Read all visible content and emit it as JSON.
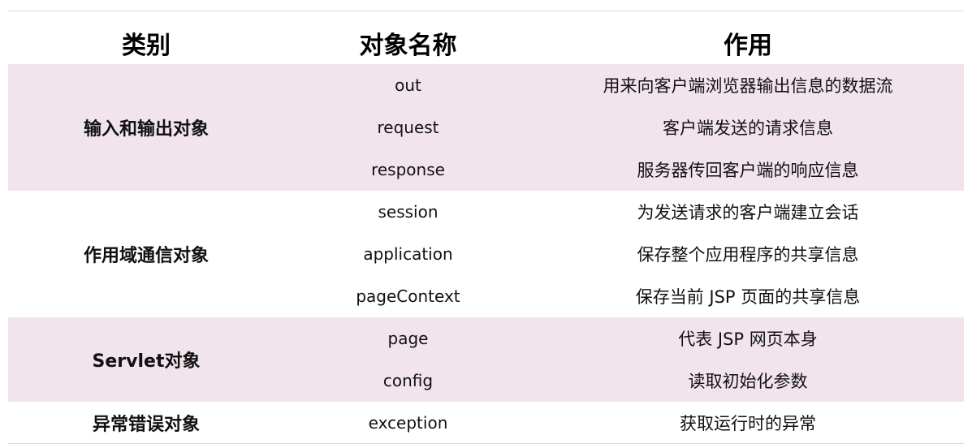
{
  "headers": {
    "category": "类别",
    "name": "对象名称",
    "purpose": "作用"
  },
  "groups": [
    {
      "category": "输入和输出对象",
      "rows": [
        {
          "name": "out",
          "purpose": "用来向客户端浏览器输出信息的数据流"
        },
        {
          "name": "request",
          "purpose": "客户端发送的请求信息"
        },
        {
          "name": "response",
          "purpose": "服务器传回客户端的响应信息"
        }
      ]
    },
    {
      "category": "作用域通信对象",
      "rows": [
        {
          "name": "session",
          "purpose": "为发送请求的客户端建立会话"
        },
        {
          "name": "application",
          "purpose": "保存整个应用程序的共享信息"
        },
        {
          "name": "pageContext",
          "purpose": "保存当前 JSP 页面的共享信息"
        }
      ]
    },
    {
      "category": "Servlet对象",
      "rows": [
        {
          "name": "page",
          "purpose": "代表 JSP 网页本身"
        },
        {
          "name": "config",
          "purpose": "读取初始化参数"
        }
      ]
    },
    {
      "category": "异常错误对象",
      "rows": [
        {
          "name": "exception",
          "purpose": "获取运行时的异常"
        }
      ]
    }
  ],
  "colors": {
    "shaded_row": "#f2e4ec",
    "rule": "#d9d9d9"
  }
}
